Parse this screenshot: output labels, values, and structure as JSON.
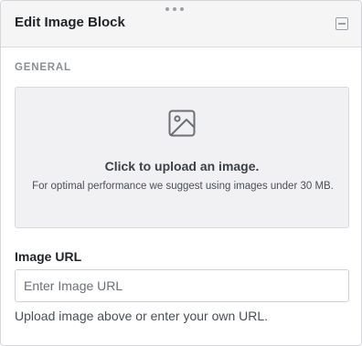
{
  "header": {
    "title": "Edit Image Block",
    "drag_icon": "drag-handle-dots-icon",
    "collapse_icon": "collapse-minus-icon"
  },
  "general": {
    "section_label": "GENERAL"
  },
  "upload": {
    "icon": "image-icon",
    "title": "Click to upload an image.",
    "hint": "For optimal performance we suggest using images under 30 MB."
  },
  "image_url": {
    "label": "Image URL",
    "placeholder": "Enter Image URL",
    "value": "",
    "help": "Upload image above or enter your own URL."
  },
  "colors": {
    "header_bg": "#f5f5f6",
    "upload_bg": "#f1f1f4",
    "muted_text": "#8a8f95"
  }
}
